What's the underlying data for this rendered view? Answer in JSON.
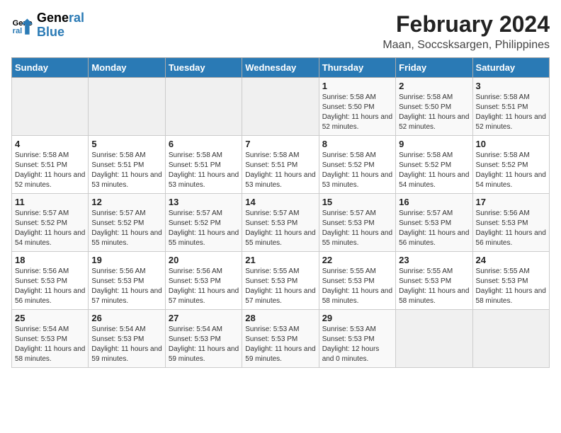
{
  "logo": {
    "line1": "General",
    "line2": "Blue"
  },
  "title": "February 2024",
  "subtitle": "Maan, Soccsksargen, Philippines",
  "days_of_week": [
    "Sunday",
    "Monday",
    "Tuesday",
    "Wednesday",
    "Thursday",
    "Friday",
    "Saturday"
  ],
  "weeks": [
    [
      {
        "num": "",
        "sunrise": "",
        "sunset": "",
        "daylight": "",
        "empty": true
      },
      {
        "num": "",
        "sunrise": "",
        "sunset": "",
        "daylight": "",
        "empty": true
      },
      {
        "num": "",
        "sunrise": "",
        "sunset": "",
        "daylight": "",
        "empty": true
      },
      {
        "num": "",
        "sunrise": "",
        "sunset": "",
        "daylight": "",
        "empty": true
      },
      {
        "num": "1",
        "sunrise": "Sunrise: 5:58 AM",
        "sunset": "Sunset: 5:50 PM",
        "daylight": "Daylight: 11 hours and 52 minutes.",
        "empty": false
      },
      {
        "num": "2",
        "sunrise": "Sunrise: 5:58 AM",
        "sunset": "Sunset: 5:50 PM",
        "daylight": "Daylight: 11 hours and 52 minutes.",
        "empty": false
      },
      {
        "num": "3",
        "sunrise": "Sunrise: 5:58 AM",
        "sunset": "Sunset: 5:51 PM",
        "daylight": "Daylight: 11 hours and 52 minutes.",
        "empty": false
      }
    ],
    [
      {
        "num": "4",
        "sunrise": "Sunrise: 5:58 AM",
        "sunset": "Sunset: 5:51 PM",
        "daylight": "Daylight: 11 hours and 52 minutes.",
        "empty": false
      },
      {
        "num": "5",
        "sunrise": "Sunrise: 5:58 AM",
        "sunset": "Sunset: 5:51 PM",
        "daylight": "Daylight: 11 hours and 53 minutes.",
        "empty": false
      },
      {
        "num": "6",
        "sunrise": "Sunrise: 5:58 AM",
        "sunset": "Sunset: 5:51 PM",
        "daylight": "Daylight: 11 hours and 53 minutes.",
        "empty": false
      },
      {
        "num": "7",
        "sunrise": "Sunrise: 5:58 AM",
        "sunset": "Sunset: 5:51 PM",
        "daylight": "Daylight: 11 hours and 53 minutes.",
        "empty": false
      },
      {
        "num": "8",
        "sunrise": "Sunrise: 5:58 AM",
        "sunset": "Sunset: 5:52 PM",
        "daylight": "Daylight: 11 hours and 53 minutes.",
        "empty": false
      },
      {
        "num": "9",
        "sunrise": "Sunrise: 5:58 AM",
        "sunset": "Sunset: 5:52 PM",
        "daylight": "Daylight: 11 hours and 54 minutes.",
        "empty": false
      },
      {
        "num": "10",
        "sunrise": "Sunrise: 5:58 AM",
        "sunset": "Sunset: 5:52 PM",
        "daylight": "Daylight: 11 hours and 54 minutes.",
        "empty": false
      }
    ],
    [
      {
        "num": "11",
        "sunrise": "Sunrise: 5:57 AM",
        "sunset": "Sunset: 5:52 PM",
        "daylight": "Daylight: 11 hours and 54 minutes.",
        "empty": false
      },
      {
        "num": "12",
        "sunrise": "Sunrise: 5:57 AM",
        "sunset": "Sunset: 5:52 PM",
        "daylight": "Daylight: 11 hours and 55 minutes.",
        "empty": false
      },
      {
        "num": "13",
        "sunrise": "Sunrise: 5:57 AM",
        "sunset": "Sunset: 5:52 PM",
        "daylight": "Daylight: 11 hours and 55 minutes.",
        "empty": false
      },
      {
        "num": "14",
        "sunrise": "Sunrise: 5:57 AM",
        "sunset": "Sunset: 5:53 PM",
        "daylight": "Daylight: 11 hours and 55 minutes.",
        "empty": false
      },
      {
        "num": "15",
        "sunrise": "Sunrise: 5:57 AM",
        "sunset": "Sunset: 5:53 PM",
        "daylight": "Daylight: 11 hours and 55 minutes.",
        "empty": false
      },
      {
        "num": "16",
        "sunrise": "Sunrise: 5:57 AM",
        "sunset": "Sunset: 5:53 PM",
        "daylight": "Daylight: 11 hours and 56 minutes.",
        "empty": false
      },
      {
        "num": "17",
        "sunrise": "Sunrise: 5:56 AM",
        "sunset": "Sunset: 5:53 PM",
        "daylight": "Daylight: 11 hours and 56 minutes.",
        "empty": false
      }
    ],
    [
      {
        "num": "18",
        "sunrise": "Sunrise: 5:56 AM",
        "sunset": "Sunset: 5:53 PM",
        "daylight": "Daylight: 11 hours and 56 minutes.",
        "empty": false
      },
      {
        "num": "19",
        "sunrise": "Sunrise: 5:56 AM",
        "sunset": "Sunset: 5:53 PM",
        "daylight": "Daylight: 11 hours and 57 minutes.",
        "empty": false
      },
      {
        "num": "20",
        "sunrise": "Sunrise: 5:56 AM",
        "sunset": "Sunset: 5:53 PM",
        "daylight": "Daylight: 11 hours and 57 minutes.",
        "empty": false
      },
      {
        "num": "21",
        "sunrise": "Sunrise: 5:55 AM",
        "sunset": "Sunset: 5:53 PM",
        "daylight": "Daylight: 11 hours and 57 minutes.",
        "empty": false
      },
      {
        "num": "22",
        "sunrise": "Sunrise: 5:55 AM",
        "sunset": "Sunset: 5:53 PM",
        "daylight": "Daylight: 11 hours and 58 minutes.",
        "empty": false
      },
      {
        "num": "23",
        "sunrise": "Sunrise: 5:55 AM",
        "sunset": "Sunset: 5:53 PM",
        "daylight": "Daylight: 11 hours and 58 minutes.",
        "empty": false
      },
      {
        "num": "24",
        "sunrise": "Sunrise: 5:55 AM",
        "sunset": "Sunset: 5:53 PM",
        "daylight": "Daylight: 11 hours and 58 minutes.",
        "empty": false
      }
    ],
    [
      {
        "num": "25",
        "sunrise": "Sunrise: 5:54 AM",
        "sunset": "Sunset: 5:53 PM",
        "daylight": "Daylight: 11 hours and 58 minutes.",
        "empty": false
      },
      {
        "num": "26",
        "sunrise": "Sunrise: 5:54 AM",
        "sunset": "Sunset: 5:53 PM",
        "daylight": "Daylight: 11 hours and 59 minutes.",
        "empty": false
      },
      {
        "num": "27",
        "sunrise": "Sunrise: 5:54 AM",
        "sunset": "Sunset: 5:53 PM",
        "daylight": "Daylight: 11 hours and 59 minutes.",
        "empty": false
      },
      {
        "num": "28",
        "sunrise": "Sunrise: 5:53 AM",
        "sunset": "Sunset: 5:53 PM",
        "daylight": "Daylight: 11 hours and 59 minutes.",
        "empty": false
      },
      {
        "num": "29",
        "sunrise": "Sunrise: 5:53 AM",
        "sunset": "Sunset: 5:53 PM",
        "daylight": "Daylight: 12 hours and 0 minutes.",
        "empty": false
      },
      {
        "num": "",
        "sunrise": "",
        "sunset": "",
        "daylight": "",
        "empty": true
      },
      {
        "num": "",
        "sunrise": "",
        "sunset": "",
        "daylight": "",
        "empty": true
      }
    ]
  ]
}
